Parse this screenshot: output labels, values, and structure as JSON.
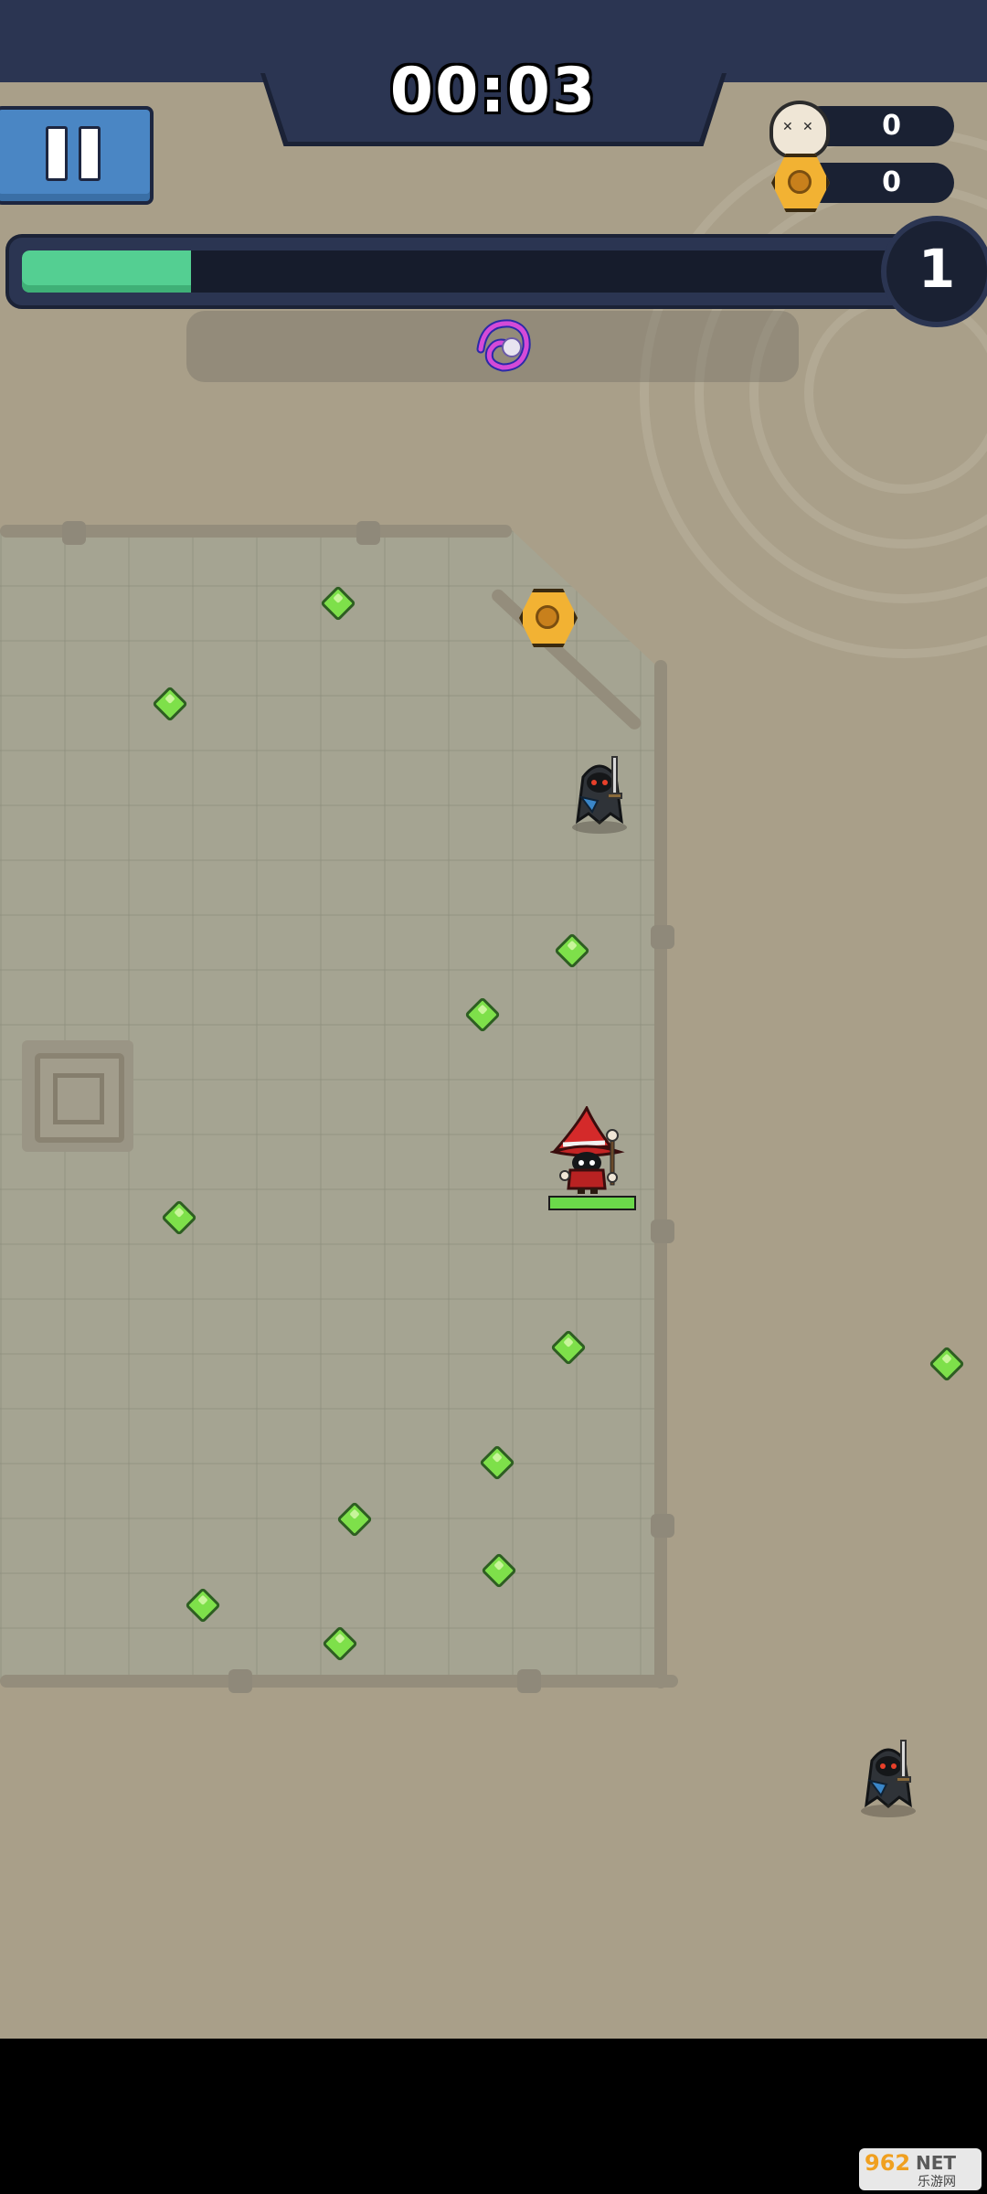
{
  "hud": {
    "timer": "00:03",
    "kills": "0",
    "coins": "0",
    "level": "1",
    "xp_progress": 0.19,
    "pause_icon": "pause-icon",
    "kills_icon": "skull-icon",
    "coins_icon": "coin-icon",
    "skill_icon": "spiral-orb-icon"
  },
  "player": {
    "character": "red-hat-wizard",
    "hp_fraction": 1.0
  },
  "enemies": [
    {
      "type": "hooded-swordsman"
    },
    {
      "type": "hooded-swordsman"
    }
  ],
  "pickups": {
    "xp_gem_count": 14,
    "coin_count": 1
  },
  "colors": {
    "hud_navy": "#2b3552",
    "xp_green": "#54cf92",
    "pause_blue": "#4a86c4",
    "gem_green": "#7ee04a",
    "coin_gold": "#f2b233",
    "ground": "#a99f89",
    "arena_stone": "#a5a492"
  },
  "watermark": {
    "main": "962",
    "net": "NET",
    "sub": "乐游网"
  }
}
